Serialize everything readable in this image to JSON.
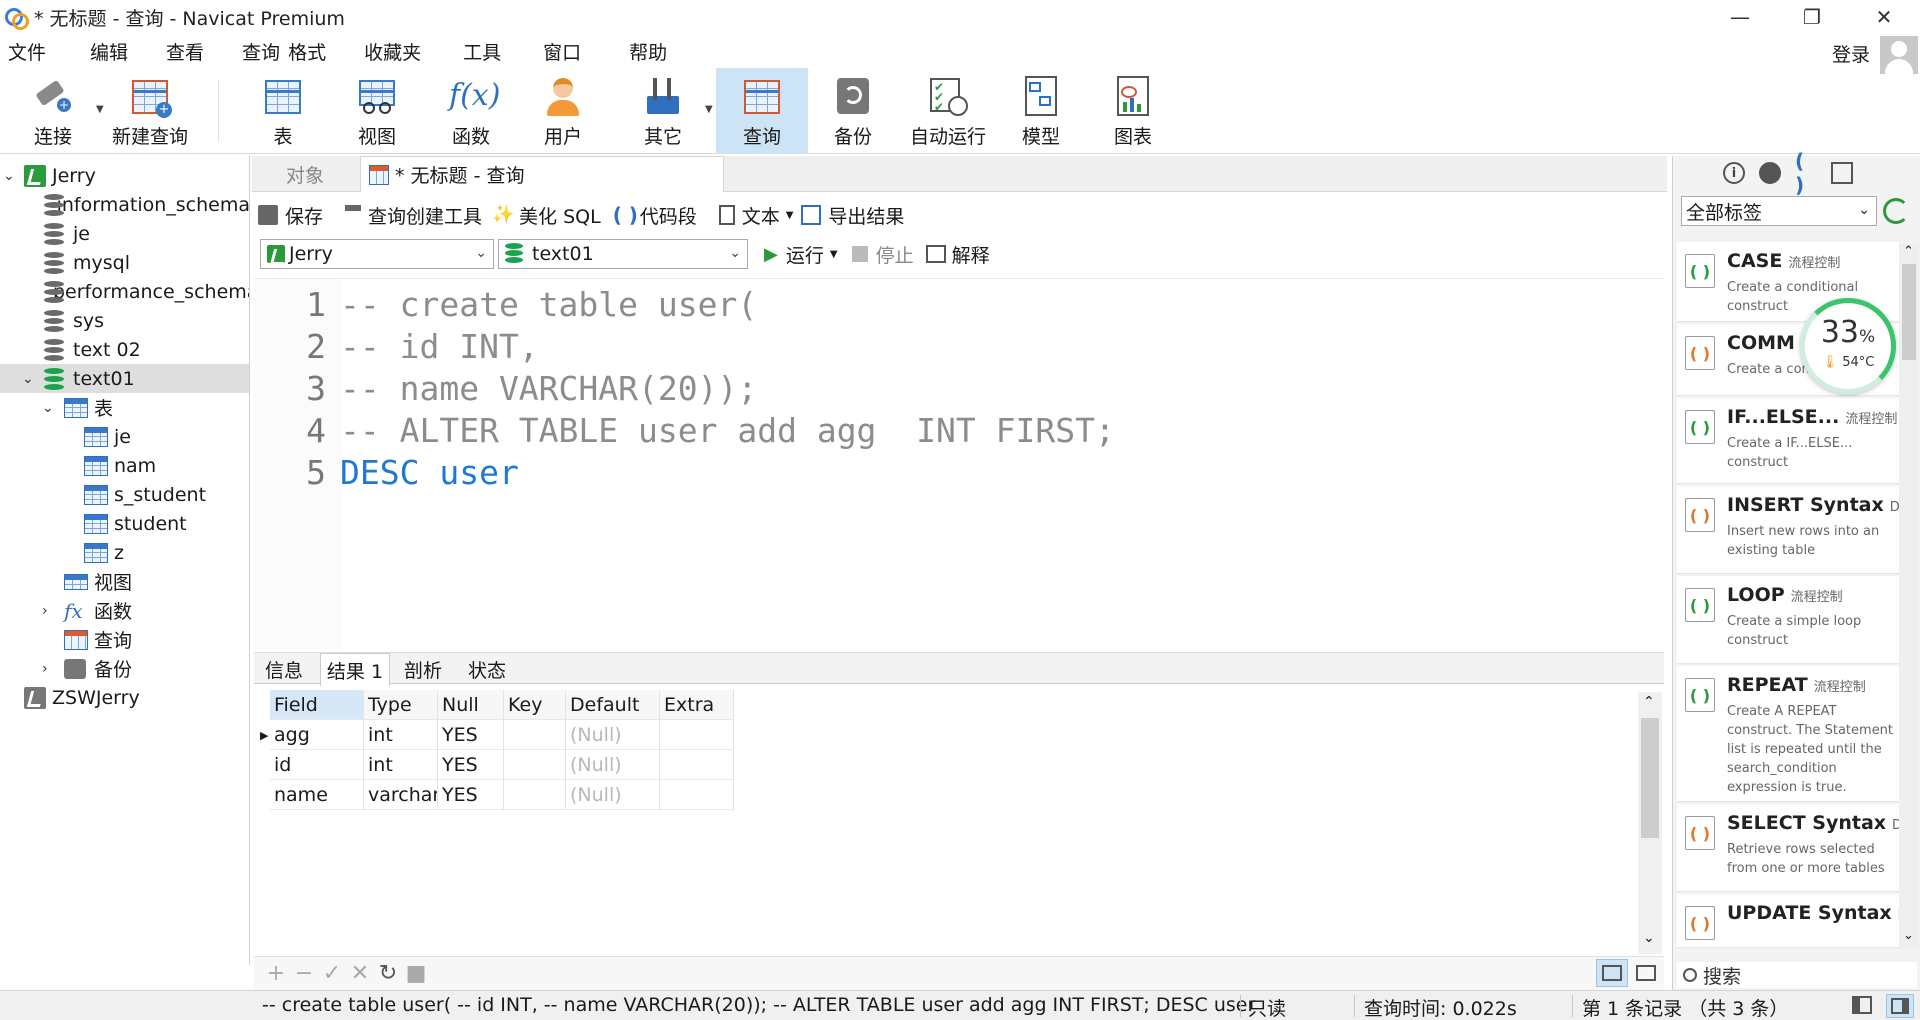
{
  "window": {
    "title": "* 无标题 - 查询 - Navicat Premium",
    "minimize": "—",
    "restore": "❐",
    "close": "✕"
  },
  "menu": [
    "文件",
    "编辑",
    "查看",
    "查询",
    "格式",
    "收藏夹",
    "工具",
    "窗口",
    "帮助"
  ],
  "login": "登录",
  "toolbar": [
    "连接",
    "新建查询",
    "表",
    "视图",
    "函数",
    "用户",
    "其它",
    "查询",
    "备份",
    "自动运行",
    "模型",
    "图表"
  ],
  "tree": {
    "root": "Jerry",
    "databases": [
      "information_schema",
      "je",
      "mysql",
      "performance_schema",
      "sys",
      "text 02",
      "text01"
    ],
    "group_tables": "表",
    "tables": [
      "je",
      "nam",
      "s_student",
      "student",
      "z"
    ],
    "group_views": "视图",
    "group_functions": "函数",
    "group_queries": "查询",
    "group_backups": "备份",
    "second_connection": "ZSWJerry"
  },
  "tabs": {
    "objects": "对象",
    "query": "* 无标题 - 查询"
  },
  "query_toolbar": {
    "save": "保存",
    "builder": "查询创建工具",
    "beautify": "美化 SQL",
    "snippet": "代码段",
    "text": "文本",
    "export": "导出结果"
  },
  "selectors": {
    "connection": "Jerry",
    "database": "text01",
    "run": "运行",
    "stop": "停止",
    "explain": "解释"
  },
  "code": [
    {
      "n": "1",
      "text": "-- create table user("
    },
    {
      "n": "2",
      "text": "-- id INT,"
    },
    {
      "n": "3",
      "text": "-- name VARCHAR(20));"
    },
    {
      "n": "4",
      "text": "-- ALTER TABLE user add agg  INT FIRST;"
    },
    {
      "n": "5",
      "text": "DESC user"
    }
  ],
  "result_tabs": [
    "信息",
    "结果 1",
    "剖析",
    "状态"
  ],
  "result": {
    "columns": [
      "Field",
      "Type",
      "Null",
      "Key",
      "Default",
      "Extra"
    ],
    "rows": [
      [
        "agg",
        "int",
        "YES",
        "",
        "(Null)",
        ""
      ],
      [
        "id",
        "int",
        "YES",
        "",
        "(Null)",
        ""
      ],
      [
        "name",
        "varchar(",
        "YES",
        "",
        "(Null)",
        ""
      ]
    ]
  },
  "status": {
    "sql": "-- create table user( -- id INT, -- name VARCHAR(20)); -- ALTER TABLE user add agg  INT FIRST; DESC user",
    "readonly": "只读",
    "time": "查询时间: 0.022s",
    "records": "第 1 条记录 （共 3 条）"
  },
  "right_panel": {
    "filter": "全部标签",
    "search": "搜索",
    "snippets": [
      {
        "title": "CASE",
        "cat": "流程控制",
        "desc": "Create a conditional construct"
      },
      {
        "title": "COMM",
        "cat": "",
        "desc": "Create a com"
      },
      {
        "title": "IF...ELSE...",
        "cat": "流程控制",
        "desc": "Create a IF...ELSE... construct"
      },
      {
        "title": "INSERT Syntax",
        "cat": "DM",
        "desc": "Insert new rows into an existing table"
      },
      {
        "title": "LOOP",
        "cat": "流程控制",
        "desc": "Create a simple loop construct"
      },
      {
        "title": "REPEAT",
        "cat": "流程控制",
        "desc": "Create A REPEAT construct. The Statement list is repeated until the search_condition expression is true."
      },
      {
        "title": "SELECT Syntax",
        "cat": "DM",
        "desc": "Retrieve rows selected from one or more tables"
      },
      {
        "title": "UPDATE Syntax",
        "cat": "D",
        "desc": ""
      }
    ]
  },
  "gauge": {
    "percent": "33",
    "unit": "%",
    "temp": "54°C",
    "percent_value": 33
  }
}
